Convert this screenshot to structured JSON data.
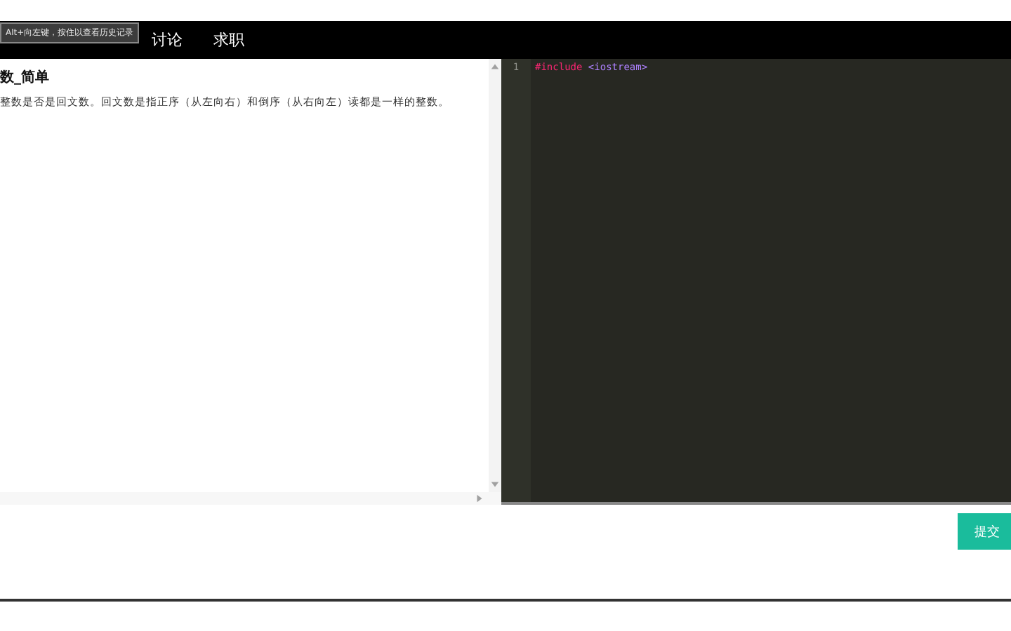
{
  "nav": {
    "items": [
      {
        "label": "讨论"
      },
      {
        "label": "求职"
      }
    ]
  },
  "tooltip": {
    "text": "Alt+向左键，按住以查看历史记录"
  },
  "problem": {
    "title": "数_简单",
    "description": "整数是否是回文数。回文数是指正序（从左向右）和倒序（从右向左）读都是一样的整数。"
  },
  "editor": {
    "lines": [
      {
        "number": "1",
        "tokens": [
          {
            "kind": "keyword",
            "text": "#include"
          },
          {
            "kind": "string",
            "text": " <iostream>"
          }
        ]
      }
    ]
  },
  "submit_button": {
    "label": "提交"
  }
}
